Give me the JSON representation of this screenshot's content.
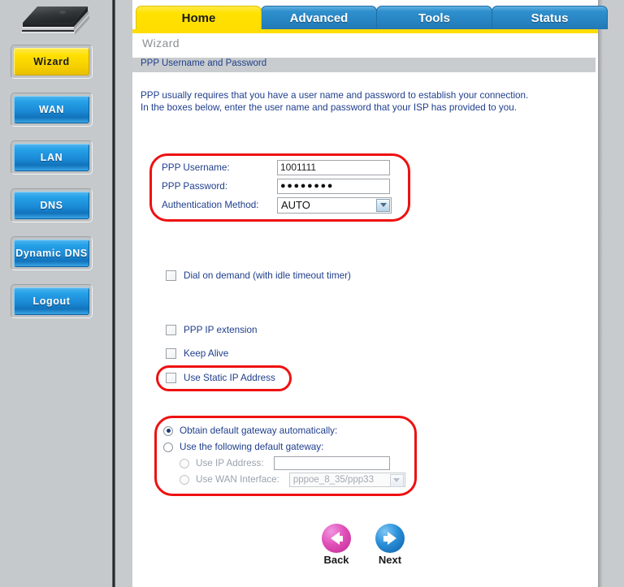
{
  "sidebar": {
    "device_icon": "router-device-image",
    "items": [
      {
        "label": "Wizard",
        "state": "active"
      },
      {
        "label": "WAN",
        "state": "normal"
      },
      {
        "label": "LAN",
        "state": "normal"
      },
      {
        "label": "DNS",
        "state": "normal"
      },
      {
        "label": "Dynamic DNS",
        "state": "normal"
      },
      {
        "label": "Logout",
        "state": "normal"
      }
    ]
  },
  "tabs": [
    {
      "label": "Home",
      "active": true
    },
    {
      "label": "Advanced",
      "active": false
    },
    {
      "label": "Tools",
      "active": false
    },
    {
      "label": "Status",
      "active": false
    }
  ],
  "page": {
    "title": "Wizard",
    "section_title": "PPP Username and Password",
    "description_line1": "PPP usually requires that you have a user name and password to establish your connection.",
    "description_line2": "In the boxes below, enter the user name and password that your ISP has provided to you."
  },
  "credentials": {
    "username_label": "PPP Username:",
    "username_value": "1001111",
    "password_label": "PPP Password:",
    "password_value": "●●●●●●●●",
    "auth_label": "Authentication Method:",
    "auth_value": "AUTO"
  },
  "checkboxes": [
    {
      "label": "Dial on demand (with idle timeout timer)",
      "checked": false
    },
    {
      "label": "PPP IP extension",
      "checked": false
    },
    {
      "label": "Keep Alive",
      "checked": false
    },
    {
      "label": "Use Static IP Address",
      "checked": false
    }
  ],
  "gateway": {
    "option_auto": "Obtain default gateway automatically:",
    "option_manual": "Use the following default gateway:",
    "option_ip": "Use IP Address:",
    "ip_value": "",
    "option_wan": "Use WAN Interface:",
    "wan_value": "pppoe_8_35/ppp33"
  },
  "nav": {
    "back_label": "Back",
    "next_label": "Next",
    "back_icon": "left-arrow-icon",
    "next_icon": "right-arrow-icon"
  },
  "colors": {
    "accent_yellow": "#ffdd00",
    "tab_blue": "#2682c0",
    "link_blue": "#1f3e8c",
    "annotation_red": "#ee1111",
    "sidebar_grey": "#c6c9cb"
  }
}
